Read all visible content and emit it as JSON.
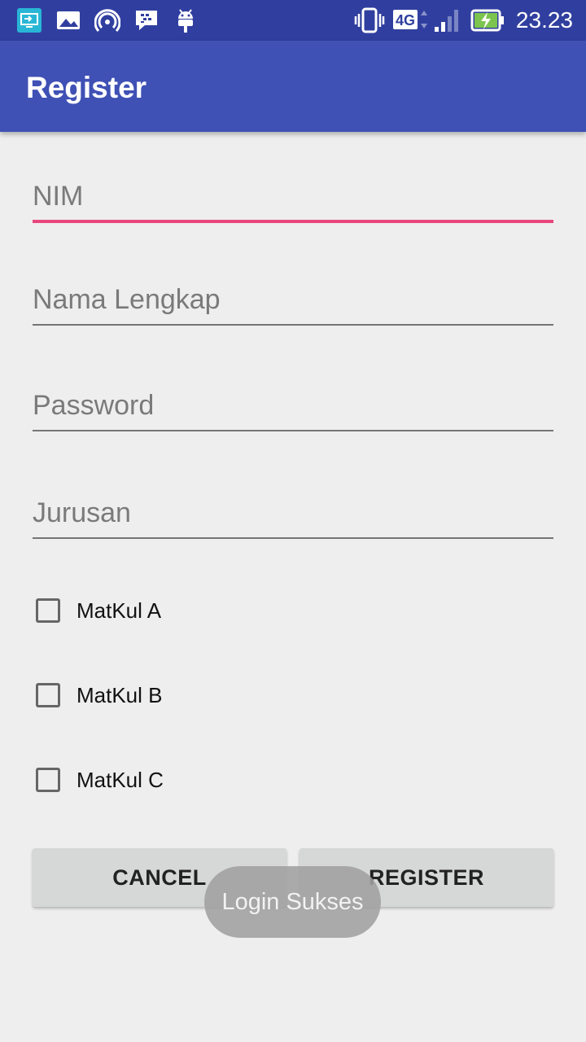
{
  "status_bar": {
    "time": "23.23",
    "network": "4G",
    "icons": [
      "screen-cast-icon",
      "gallery-icon",
      "hotspot-icon",
      "bbm-icon",
      "android-icon",
      "vibrate-icon",
      "network-4g-icon",
      "signal-icon",
      "battery-charging-icon"
    ]
  },
  "app_bar": {
    "title": "Register"
  },
  "form": {
    "nim_placeholder": "NIM",
    "nama_placeholder": "Nama Lengkap",
    "password_placeholder": "Password",
    "jurusan_placeholder": "Jurusan",
    "checkboxes": [
      {
        "label": "MatKul A",
        "checked": false
      },
      {
        "label": "MatKul B",
        "checked": false
      },
      {
        "label": "MatKul C",
        "checked": false
      }
    ],
    "cancel_label": "CANCEL",
    "register_label": "REGISTER"
  },
  "toast": {
    "text": "Login Sukses"
  },
  "colors": {
    "status_bar": "#303f9f",
    "app_bar": "#3f51b5",
    "accent": "#e8467c",
    "background": "#eeeeee",
    "button": "#d6d7d7"
  }
}
